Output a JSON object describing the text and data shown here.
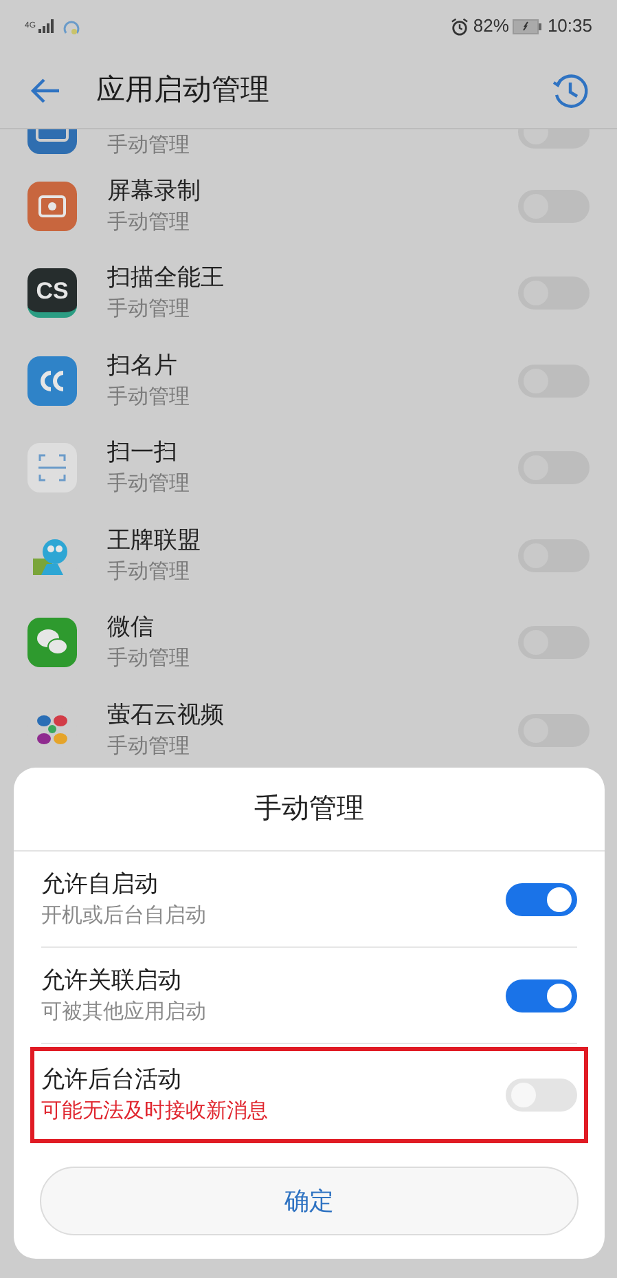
{
  "status_bar": {
    "network": "4G",
    "battery": "82%",
    "time": "10:35"
  },
  "header": {
    "title": "应用启动管理"
  },
  "apps": [
    {
      "subtitle": "手动管理",
      "on": false,
      "kind": "partial"
    },
    {
      "name": "屏幕录制",
      "subtitle": "手动管理",
      "on": false,
      "kind": "app"
    },
    {
      "name": "扫描全能王",
      "subtitle": "手动管理",
      "on": false,
      "kind": "app",
      "icon_text": "CS"
    },
    {
      "name": "扫名片",
      "subtitle": "手动管理",
      "on": false,
      "kind": "app"
    },
    {
      "name": "扫一扫",
      "subtitle": "手动管理",
      "on": false,
      "kind": "app"
    },
    {
      "name": "王牌联盟",
      "subtitle": "手动管理",
      "on": false,
      "kind": "app"
    },
    {
      "name": "微信",
      "subtitle": "手动管理",
      "on": false,
      "kind": "app"
    },
    {
      "name": "萤石云视频",
      "subtitle": "手动管理",
      "on": false,
      "kind": "app"
    }
  ],
  "dialog": {
    "title": "手动管理",
    "options": [
      {
        "label": "允许自启动",
        "description": "开机或后台自启动",
        "on": true,
        "warning": false,
        "highlighted": false
      },
      {
        "label": "允许关联启动",
        "description": "可被其他应用启动",
        "on": true,
        "warning": false,
        "highlighted": false
      },
      {
        "label": "允许后台活动",
        "description": "可能无法及时接收新消息",
        "on": false,
        "warning": true,
        "highlighted": true
      }
    ],
    "confirm": "确定"
  }
}
